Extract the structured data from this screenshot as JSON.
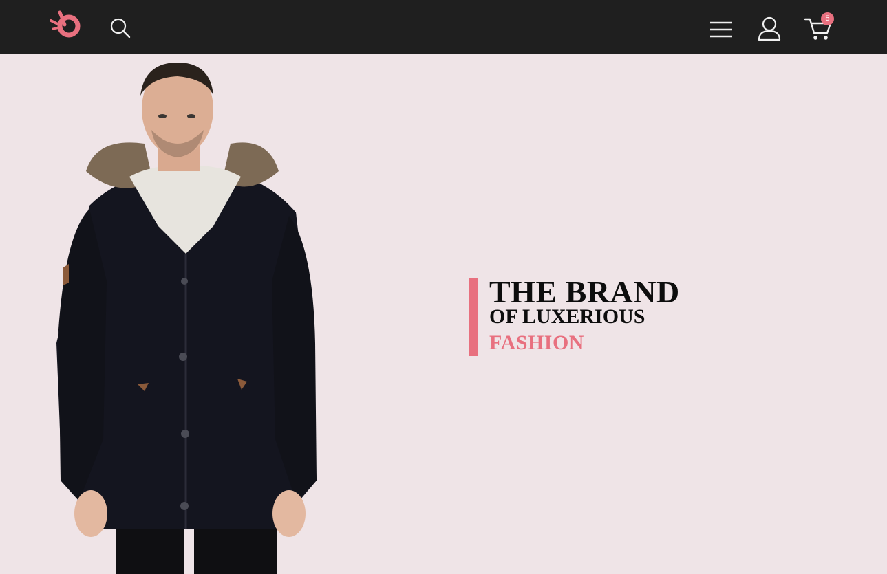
{
  "header": {
    "logo": "logo",
    "search_icon": "search-icon",
    "menu_icon": "hamburger-menu-icon",
    "account_icon": "user-icon",
    "cart_icon": "cart-icon",
    "cart_count": "5"
  },
  "hero": {
    "image": "model-in-parka-image",
    "title_line1": "THE BRAND",
    "title_line2": "OF LUXERIOUS",
    "title_line3": "FASHION"
  },
  "colors": {
    "header_bg": "#1f1f1f",
    "hero_bg": "#efe4e7",
    "accent": "#e8707f",
    "text": "#0d0d0d"
  }
}
